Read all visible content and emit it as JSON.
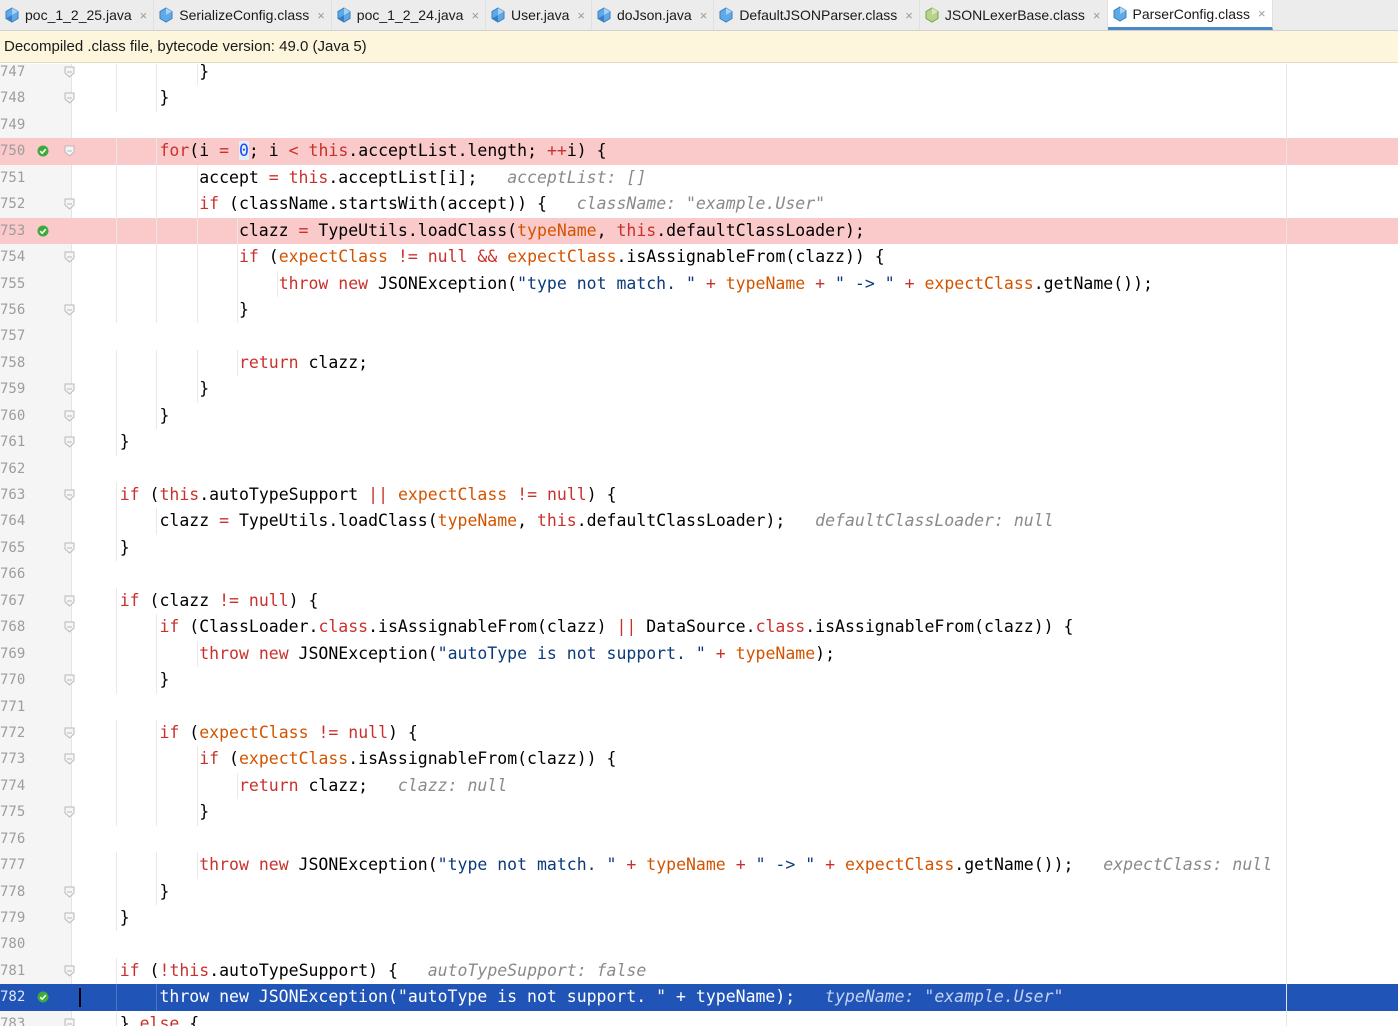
{
  "tabs": [
    {
      "label": "poc_1_2_25.java",
      "icon": "java-class-icon",
      "active": false
    },
    {
      "label": "SerializeConfig.class",
      "icon": "compiled-class-icon",
      "active": false
    },
    {
      "label": "poc_1_2_24.java",
      "icon": "java-class-icon",
      "active": false
    },
    {
      "label": "User.java",
      "icon": "java-class-icon",
      "active": false
    },
    {
      "label": "doJson.java",
      "icon": "java-class-icon",
      "active": false
    },
    {
      "label": "DefaultJSONParser.class",
      "icon": "compiled-class-icon",
      "active": false
    },
    {
      "label": "JSONLexerBase.class",
      "icon": "abstract-class-icon",
      "active": false
    },
    {
      "label": "ParserConfig.class",
      "icon": "compiled-class-icon",
      "active": true
    }
  ],
  "tab_close_glyph": "×",
  "banner": {
    "text": "Decompiled .class file, bytecode version: 49.0 (Java 5)"
  },
  "colors": {
    "accent": "#4a88c7",
    "breakpoint_line": "#fac9c9",
    "current_line": "#2154b7",
    "keyword": "#c9312c",
    "field": "#d35400",
    "hint": "#8a8a8a",
    "verified_breakpoint": "#3caa3c"
  },
  "lines": [
    {
      "n": "747",
      "fold": true,
      "tokens": [
        {
          "t": "            }"
        }
      ]
    },
    {
      "n": "748",
      "fold": true,
      "tokens": [
        {
          "t": "        }"
        }
      ]
    },
    {
      "n": "749",
      "tokens": []
    },
    {
      "n": "750",
      "fold": true,
      "bp": true,
      "tokens": [
        {
          "t": "        "
        },
        {
          "t": "for",
          "c": "kw"
        },
        {
          "t": "(i "
        },
        {
          "t": "=",
          "c": "op"
        },
        {
          "t": " "
        },
        {
          "t": "0",
          "c": "num"
        },
        {
          "t": "; i "
        },
        {
          "t": "<",
          "c": "op"
        },
        {
          "t": " "
        },
        {
          "t": "this",
          "c": "kw"
        },
        {
          "t": ".acceptList.length; "
        },
        {
          "t": "++",
          "c": "op"
        },
        {
          "t": "i) {"
        }
      ]
    },
    {
      "n": "751",
      "tokens": [
        {
          "t": "            accept "
        },
        {
          "t": "=",
          "c": "op"
        },
        {
          "t": " "
        },
        {
          "t": "this",
          "c": "kw"
        },
        {
          "t": ".acceptList[i];   "
        },
        {
          "t": "acceptList: []",
          "c": "hint"
        }
      ]
    },
    {
      "n": "752",
      "fold": true,
      "tokens": [
        {
          "t": "            "
        },
        {
          "t": "if",
          "c": "kw"
        },
        {
          "t": " (className.startsWith(accept)) {   "
        },
        {
          "t": "className: \"example.User\"",
          "c": "hint"
        }
      ]
    },
    {
      "n": "753",
      "bp": true,
      "tokens": [
        {
          "t": "                clazz "
        },
        {
          "t": "=",
          "c": "op"
        },
        {
          "t": " TypeUtils.loadClass("
        },
        {
          "t": "typeName",
          "c": "fld"
        },
        {
          "t": ", "
        },
        {
          "t": "this",
          "c": "kw"
        },
        {
          "t": ".defaultClassLoader);"
        }
      ]
    },
    {
      "n": "754",
      "fold": true,
      "tokens": [
        {
          "t": "                "
        },
        {
          "t": "if",
          "c": "kw"
        },
        {
          "t": " ("
        },
        {
          "t": "expectClass",
          "c": "fld"
        },
        {
          "t": " "
        },
        {
          "t": "!=",
          "c": "op"
        },
        {
          "t": " "
        },
        {
          "t": "null",
          "c": "kw"
        },
        {
          "t": " "
        },
        {
          "t": "&&",
          "c": "op"
        },
        {
          "t": " "
        },
        {
          "t": "expectClass",
          "c": "fld"
        },
        {
          "t": ".isAssignableFrom(clazz)) {"
        }
      ]
    },
    {
      "n": "755",
      "tokens": [
        {
          "t": "                    "
        },
        {
          "t": "throw new",
          "c": "kw"
        },
        {
          "t": " JSONException("
        },
        {
          "t": "\"type not match. \"",
          "c": "str"
        },
        {
          "t": " "
        },
        {
          "t": "+",
          "c": "op"
        },
        {
          "t": " "
        },
        {
          "t": "typeName",
          "c": "fld"
        },
        {
          "t": " "
        },
        {
          "t": "+",
          "c": "op"
        },
        {
          "t": " "
        },
        {
          "t": "\" -> \"",
          "c": "str"
        },
        {
          "t": " "
        },
        {
          "t": "+",
          "c": "op"
        },
        {
          "t": " "
        },
        {
          "t": "expectClass",
          "c": "fld"
        },
        {
          "t": ".getName());"
        }
      ]
    },
    {
      "n": "756",
      "fold": true,
      "tokens": [
        {
          "t": "                }"
        }
      ]
    },
    {
      "n": "757",
      "tokens": []
    },
    {
      "n": "758",
      "tokens": [
        {
          "t": "                "
        },
        {
          "t": "return",
          "c": "kw"
        },
        {
          "t": " clazz;"
        }
      ]
    },
    {
      "n": "759",
      "fold": true,
      "tokens": [
        {
          "t": "            }"
        }
      ]
    },
    {
      "n": "760",
      "fold": true,
      "tokens": [
        {
          "t": "        }"
        }
      ]
    },
    {
      "n": "761",
      "fold": true,
      "tokens": [
        {
          "t": "    }"
        }
      ]
    },
    {
      "n": "762",
      "tokens": []
    },
    {
      "n": "763",
      "fold": true,
      "tokens": [
        {
          "t": "    "
        },
        {
          "t": "if",
          "c": "kw"
        },
        {
          "t": " ("
        },
        {
          "t": "this",
          "c": "kw"
        },
        {
          "t": ".autoTypeSupport "
        },
        {
          "t": "||",
          "c": "op"
        },
        {
          "t": " "
        },
        {
          "t": "expectClass",
          "c": "fld"
        },
        {
          "t": " "
        },
        {
          "t": "!=",
          "c": "op"
        },
        {
          "t": " "
        },
        {
          "t": "null",
          "c": "kw"
        },
        {
          "t": ") {"
        }
      ]
    },
    {
      "n": "764",
      "tokens": [
        {
          "t": "        clazz "
        },
        {
          "t": "=",
          "c": "op"
        },
        {
          "t": " TypeUtils.loadClass("
        },
        {
          "t": "typeName",
          "c": "fld"
        },
        {
          "t": ", "
        },
        {
          "t": "this",
          "c": "kw"
        },
        {
          "t": ".defaultClassLoader);   "
        },
        {
          "t": "defaultClassLoader: null",
          "c": "hint"
        }
      ]
    },
    {
      "n": "765",
      "fold": true,
      "tokens": [
        {
          "t": "    }"
        }
      ]
    },
    {
      "n": "766",
      "tokens": []
    },
    {
      "n": "767",
      "fold": true,
      "tokens": [
        {
          "t": "    "
        },
        {
          "t": "if",
          "c": "kw"
        },
        {
          "t": " (clazz "
        },
        {
          "t": "!=",
          "c": "op"
        },
        {
          "t": " "
        },
        {
          "t": "null",
          "c": "kw"
        },
        {
          "t": ") {"
        }
      ]
    },
    {
      "n": "768",
      "fold": true,
      "tokens": [
        {
          "t": "        "
        },
        {
          "t": "if",
          "c": "kw"
        },
        {
          "t": " (ClassLoader."
        },
        {
          "t": "class",
          "c": "kw"
        },
        {
          "t": ".isAssignableFrom(clazz) "
        },
        {
          "t": "||",
          "c": "op"
        },
        {
          "t": " DataSource."
        },
        {
          "t": "class",
          "c": "kw"
        },
        {
          "t": ".isAssignableFrom(clazz)) {"
        }
      ]
    },
    {
      "n": "769",
      "tokens": [
        {
          "t": "            "
        },
        {
          "t": "throw new",
          "c": "kw"
        },
        {
          "t": " JSONException("
        },
        {
          "t": "\"autoType is not support. \"",
          "c": "str"
        },
        {
          "t": " "
        },
        {
          "t": "+",
          "c": "op"
        },
        {
          "t": " "
        },
        {
          "t": "typeName",
          "c": "fld"
        },
        {
          "t": ");"
        }
      ]
    },
    {
      "n": "770",
      "fold": true,
      "tokens": [
        {
          "t": "        }"
        }
      ]
    },
    {
      "n": "771",
      "tokens": []
    },
    {
      "n": "772",
      "fold": true,
      "tokens": [
        {
          "t": "        "
        },
        {
          "t": "if",
          "c": "kw"
        },
        {
          "t": " ("
        },
        {
          "t": "expectClass",
          "c": "fld"
        },
        {
          "t": " "
        },
        {
          "t": "!=",
          "c": "op"
        },
        {
          "t": " "
        },
        {
          "t": "null",
          "c": "kw"
        },
        {
          "t": ") {"
        }
      ]
    },
    {
      "n": "773",
      "fold": true,
      "tokens": [
        {
          "t": "            "
        },
        {
          "t": "if",
          "c": "kw"
        },
        {
          "t": " ("
        },
        {
          "t": "expectClass",
          "c": "fld"
        },
        {
          "t": ".isAssignableFrom(clazz)) {"
        }
      ]
    },
    {
      "n": "774",
      "tokens": [
        {
          "t": "                "
        },
        {
          "t": "return",
          "c": "kw"
        },
        {
          "t": " clazz;   "
        },
        {
          "t": "clazz: null",
          "c": "hint"
        }
      ]
    },
    {
      "n": "775",
      "fold": true,
      "tokens": [
        {
          "t": "            }"
        }
      ]
    },
    {
      "n": "776",
      "tokens": []
    },
    {
      "n": "777",
      "tokens": [
        {
          "t": "            "
        },
        {
          "t": "throw new",
          "c": "kw"
        },
        {
          "t": " JSONException("
        },
        {
          "t": "\"type not match. \"",
          "c": "str"
        },
        {
          "t": " "
        },
        {
          "t": "+",
          "c": "op"
        },
        {
          "t": " "
        },
        {
          "t": "typeName",
          "c": "fld"
        },
        {
          "t": " "
        },
        {
          "t": "+",
          "c": "op"
        },
        {
          "t": " "
        },
        {
          "t": "\" -> \"",
          "c": "str"
        },
        {
          "t": " "
        },
        {
          "t": "+",
          "c": "op"
        },
        {
          "t": " "
        },
        {
          "t": "expectClass",
          "c": "fld"
        },
        {
          "t": ".getName());   "
        },
        {
          "t": "expectClass: null",
          "c": "hint"
        }
      ]
    },
    {
      "n": "778",
      "fold": true,
      "tokens": [
        {
          "t": "        }"
        }
      ]
    },
    {
      "n": "779",
      "fold": true,
      "tokens": [
        {
          "t": "    }"
        }
      ]
    },
    {
      "n": "780",
      "tokens": []
    },
    {
      "n": "781",
      "fold": true,
      "tokens": [
        {
          "t": "    "
        },
        {
          "t": "if",
          "c": "kw"
        },
        {
          "t": " ("
        },
        {
          "t": "!",
          "c": "op"
        },
        {
          "t": "this",
          "c": "kw"
        },
        {
          "t": ".autoTypeSupport) {   "
        },
        {
          "t": "autoTypeSupport: false",
          "c": "hint"
        }
      ]
    },
    {
      "n": "782",
      "current": true,
      "bp": true,
      "tokens": [
        {
          "t": "        throw new JSONException(\"autoType is not support. \" + typeName);   "
        },
        {
          "t": "typeName: \"example.User\"",
          "c": "hint"
        }
      ]
    },
    {
      "n": "783",
      "fold": true,
      "tokens": [
        {
          "t": "    } "
        },
        {
          "t": "else",
          "c": "kw"
        },
        {
          "t": " {"
        }
      ]
    }
  ],
  "breakpoint_verified_lines": [
    "750",
    "753",
    "782"
  ]
}
